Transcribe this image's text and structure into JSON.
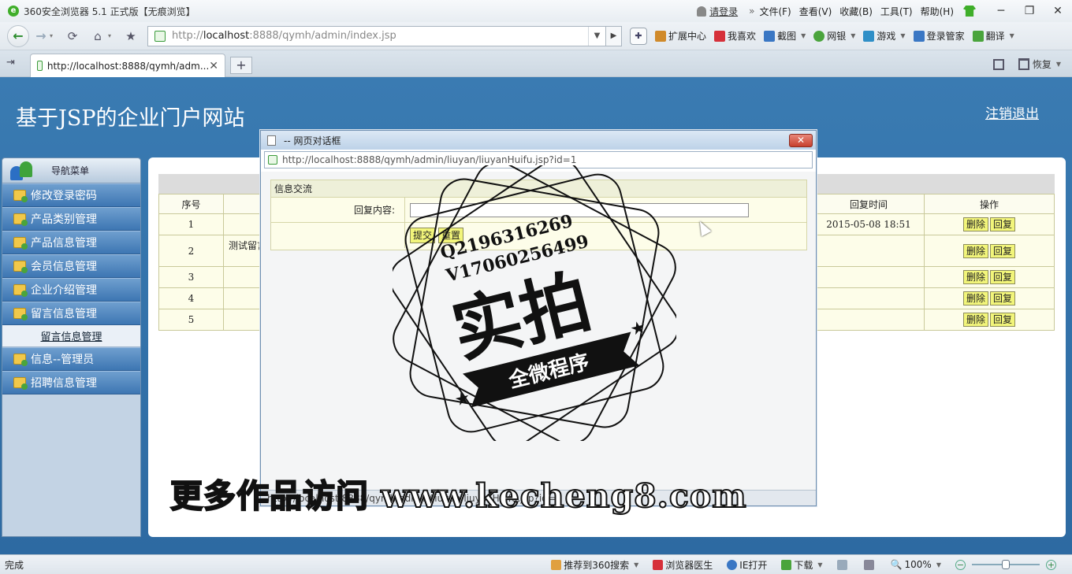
{
  "browser": {
    "title": "360安全浏览器 5.1 正式版【无痕浏览】",
    "login": "请登录",
    "menus": [
      "文件(F)",
      "查看(V)",
      "收藏(B)",
      "工具(T)",
      "帮助(H)"
    ],
    "address_prefix": "http://",
    "address_host": "localhost",
    "address_rest": ":8888/qymh/admin/index.jsp",
    "toolbar": [
      {
        "label": "扩展中心",
        "color": "#d08a2a",
        "dropdown": false
      },
      {
        "label": "我喜欢",
        "color": "#d6303a",
        "dropdown": false
      },
      {
        "label": "截图",
        "color": "#3a77c4",
        "dropdown": true
      },
      {
        "label": "网银",
        "color": "#4aa43c",
        "dropdown": true
      },
      {
        "label": "游戏",
        "color": "#2f8fc7",
        "dropdown": true
      },
      {
        "label": "登录管家",
        "color": "#3a77c4",
        "dropdown": false
      },
      {
        "label": "翻译",
        "color": "#4aa43c",
        "dropdown": true
      }
    ],
    "tab_title": "http://localhost:8888/qymh/adm...",
    "restore_label": "恢复",
    "status_done": "完成",
    "status_items": [
      {
        "label": "推荐到360搜索",
        "color": "#e0a040",
        "dropdown": true
      },
      {
        "label": "浏览器医生",
        "color": "#d6303a",
        "dropdown": false
      },
      {
        "label": "IE打开",
        "color": "#3a77c4",
        "dropdown": false
      },
      {
        "label": "下载",
        "color": "#4aa43c",
        "dropdown": true
      }
    ],
    "zoom": "100%"
  },
  "site": {
    "title": "基于JSP的企业门户网站",
    "logout": "注销退出"
  },
  "sidebar": {
    "header": "导航菜单",
    "items": [
      "修改登录密码",
      "产品类别管理",
      "产品信息管理",
      "会员信息管理",
      "企业介绍管理",
      "留言信息管理"
    ],
    "active_sub": "留言信息管理",
    "items_after": [
      "信息--管理员",
      "招聘信息管理"
    ]
  },
  "table": {
    "col_no": "序号",
    "col_reply_time": "回复时间",
    "col_ops": "操作",
    "delete_label": "删除",
    "reply_label": "回复",
    "rows": [
      {
        "no": "1",
        "msg": "",
        "time": "2015-05-08 18:51"
      },
      {
        "no": "2",
        "msg": "测试留言",
        "time": ""
      },
      {
        "no": "3",
        "msg": "",
        "time": ""
      },
      {
        "no": "4",
        "msg": "",
        "time": ""
      },
      {
        "no": "5",
        "msg": "",
        "time": ""
      }
    ]
  },
  "dialog": {
    "title": "-- 网页对话框",
    "close_label": "✕",
    "url": "http://localhost:8888/qymh/admin/liuyan/liuyanHuifu.jsp?id=1",
    "section_title": "信息交流",
    "reply_label": "回复内容:",
    "reply_value": "",
    "submit_label": "提交",
    "reset_label": "重置",
    "status_text": "http://localhost:8888/qymh/admin/liuyan/liuyanHuifu.jsp?id=1"
  },
  "watermark": {
    "line1": "Q2196316269",
    "line2": "V17060256499",
    "main": "实拍",
    "ribbon": "全微程序",
    "banner": "更多作品访问 www.kecheng8.com"
  }
}
